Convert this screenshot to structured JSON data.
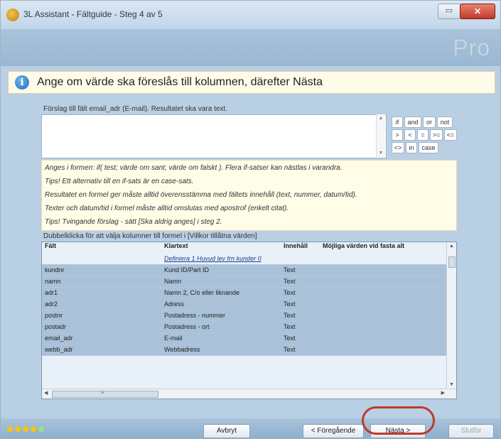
{
  "window": {
    "title": "3L Assistant - Fältguide - Steg 4 av 5",
    "min_label": "▭",
    "close_label": "✕"
  },
  "brand": {
    "logo": "Pro"
  },
  "info": {
    "icon": "i",
    "text": "Ange om värde ska föreslås till kolumnen, därefter Nästa"
  },
  "formula": {
    "label": "Förslag till fält email_adr (E-mail). Resultatet ska vara text.",
    "value": "",
    "operators": [
      [
        "if",
        "and",
        "or",
        "not"
      ],
      [
        ">",
        "<",
        "=",
        ">=",
        "<="
      ],
      [
        "<>",
        "in",
        "case"
      ]
    ]
  },
  "notes": [
    "Anges i formen: if( test; värde om sant; värde om falskt ). Flera if-satser kan nästlas i varandra.",
    "Tips! Ett alternativ till en if-sats är en case-sats.",
    "Resultatet en formel ger måste alltid överensstämma med fältets innehåll (text, nummer, datum/tid).",
    "Texter och datum/tid i formel måste alltid omslutas med apostrof (enkelt citat).",
    "Tips! Tvingande förslag - sätt [Ska aldrig anges] i steg 2."
  ],
  "columns_label": "Dubbelklicka för att välja kolumner till formel i [Villkor tillåtna värden]",
  "table": {
    "headers": [
      "Fält",
      "Klartext",
      "Innehåll",
      "Möjliga värden vid fasta alt"
    ],
    "link_row": "Definiera 1 Huvud lev frn kunder 0",
    "rows": [
      [
        "kundnr",
        "Kund ID/Part ID",
        "Text"
      ],
      [
        "namn",
        "Namn",
        "Text"
      ],
      [
        "adr1",
        "Namn 2, C/o eller liknande",
        "Text"
      ],
      [
        "adr2",
        "Adress",
        "Text"
      ],
      [
        "postnr",
        "Postadress - nummer",
        "Text"
      ],
      [
        "postadr",
        "Postadress - ort",
        "Text"
      ],
      [
        "email_adr",
        "E-mail",
        "Text"
      ],
      [
        "webb_adr",
        "Webbadress",
        "Text"
      ]
    ],
    "hscroll_grip": "≡"
  },
  "footer": {
    "dot_colors": [
      "#f5c518",
      "#f5c518",
      "#f5c518",
      "#f5c518",
      "#9be27a"
    ],
    "cancel": "Avbryt",
    "prev": "< Föregående",
    "next": "Nästa >",
    "finish": "Slutför"
  }
}
